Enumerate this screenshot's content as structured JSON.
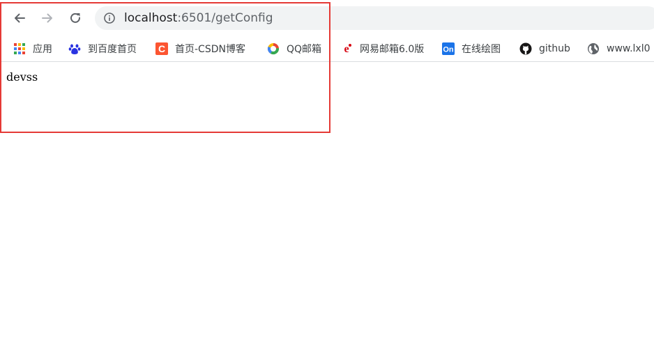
{
  "browser": {
    "url_host": "localhost",
    "url_rest": ":6501/getConfig"
  },
  "bookmarks": [
    {
      "label": "应用",
      "icon": "apps-grid-icon"
    },
    {
      "label": "到百度首页",
      "icon": "baidu-paw-icon"
    },
    {
      "label": "首页-CSDN博客",
      "icon": "csdn-c-icon"
    },
    {
      "label": "QQ邮箱",
      "icon": "qq-mail-icon"
    },
    {
      "label": "网易邮箱6.0版",
      "icon": "netease-mail-icon"
    },
    {
      "label": "在线绘图",
      "icon": "on-drawio-icon"
    },
    {
      "label": "github",
      "icon": "github-icon"
    },
    {
      "label": "www.lxl0",
      "icon": "globe-icon"
    }
  ],
  "page": {
    "body_text": "devss"
  },
  "colors": {
    "highlight": "#e53935",
    "omnibox_bg": "#f1f3f4",
    "csdn": "#fc5531",
    "on_blue": "#1a73e8"
  },
  "icon_text": {
    "csdn_letter": "C",
    "on_label": "On",
    "netease_letter": "e"
  }
}
